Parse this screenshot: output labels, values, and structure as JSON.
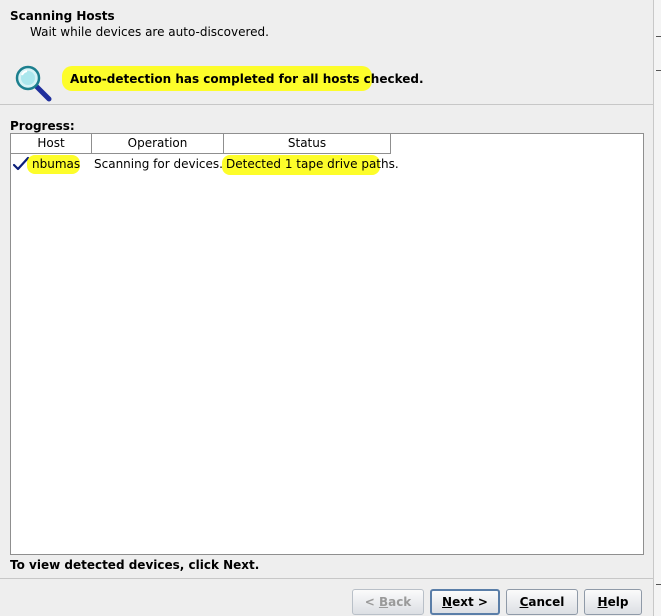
{
  "header": {
    "title": "Scanning Hosts",
    "subtitle": "Wait while devices are auto-discovered."
  },
  "status": {
    "message": "Auto-detection has completed for all hosts checked.",
    "icon": "magnifier-icon",
    "highlight_color": "#fdfd2a"
  },
  "progress": {
    "label": "Progress:",
    "columns": [
      "Host",
      "Operation",
      "Status"
    ],
    "rows": [
      {
        "check": true,
        "host": "nbumas",
        "operation": "Scanning for devices.",
        "status": "Detected 1 tape drive paths."
      }
    ]
  },
  "hint": "To view detected devices, click Next.",
  "buttons": {
    "back": {
      "mnemonic": "B",
      "rest": "ack",
      "prefix": "< "
    },
    "next": {
      "mnemonic": "N",
      "rest": "ext >"
    },
    "cancel": {
      "mnemonic": "C",
      "rest": "ancel"
    },
    "help": {
      "mnemonic": "H",
      "rest": "elp"
    }
  }
}
